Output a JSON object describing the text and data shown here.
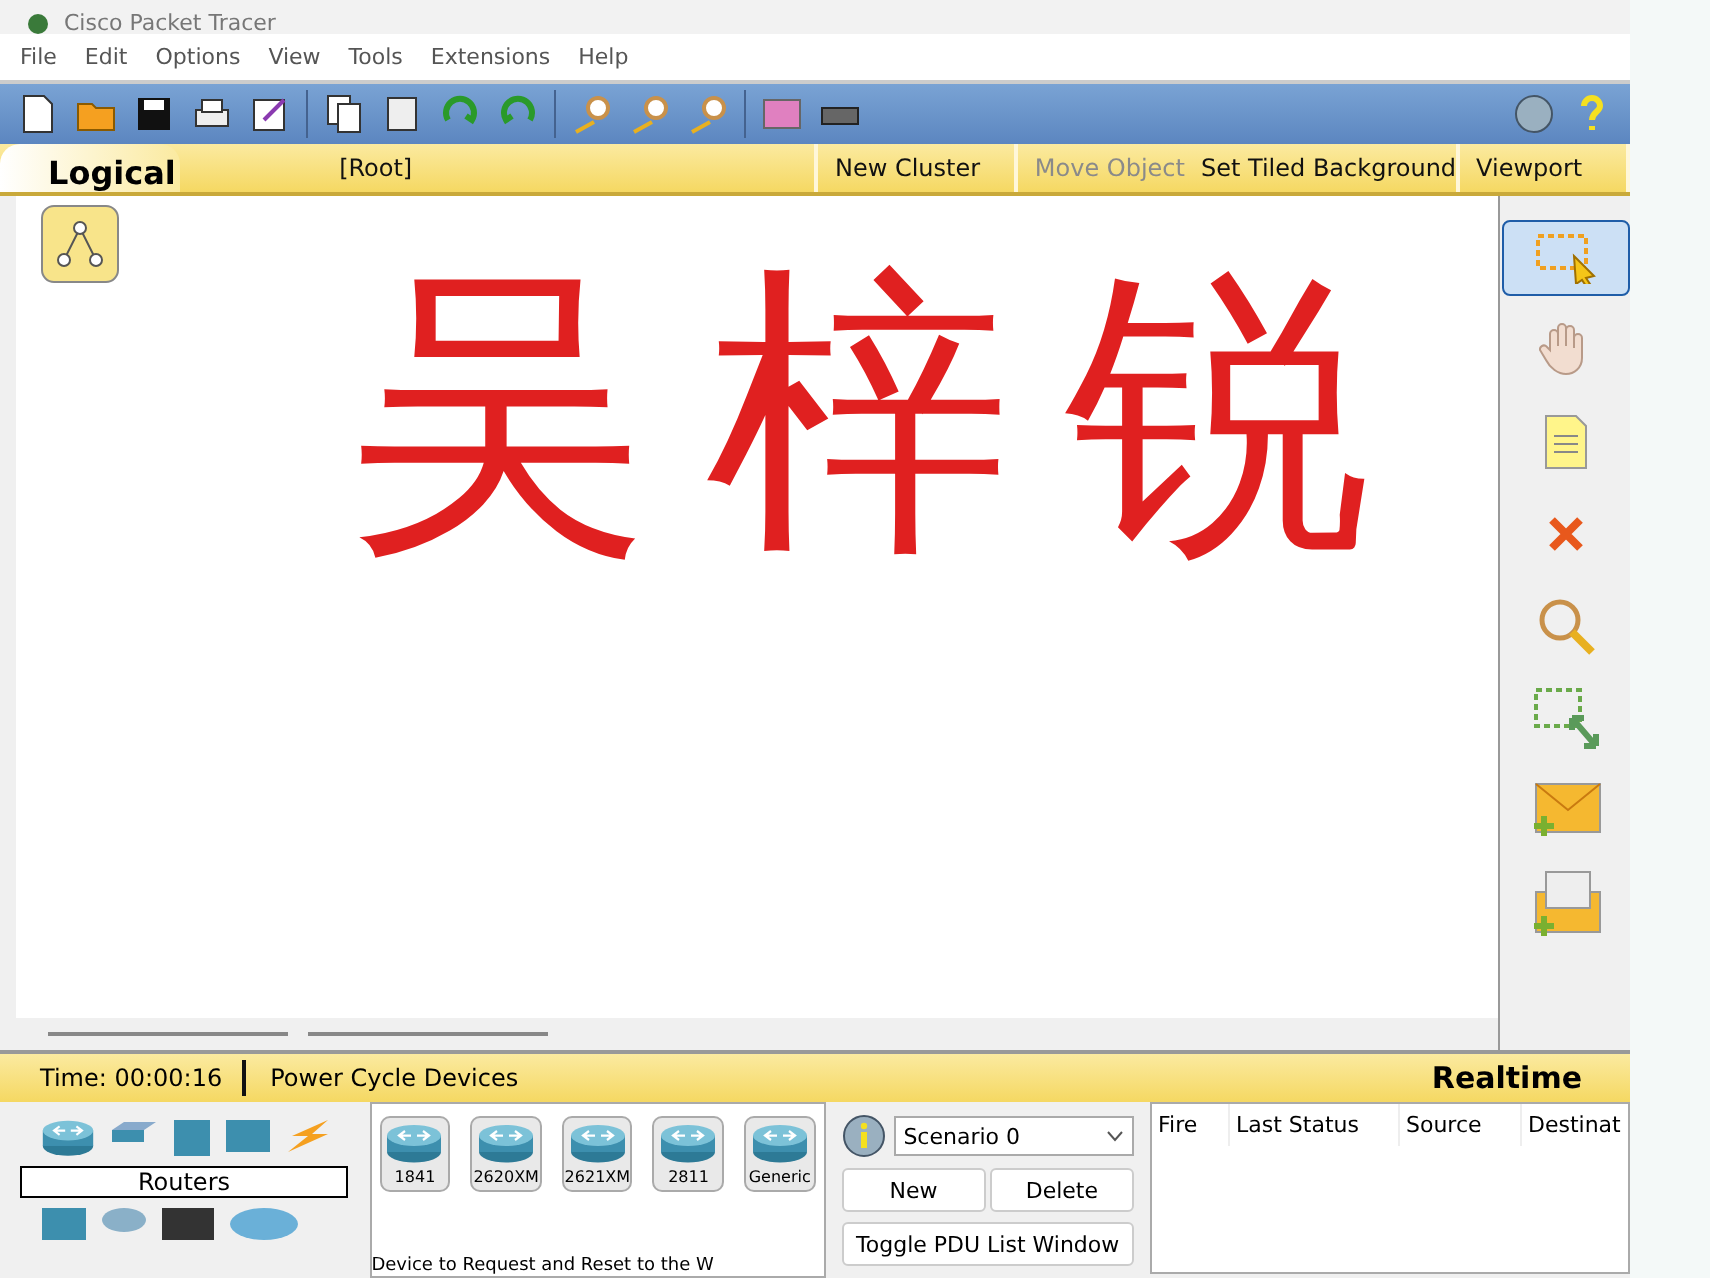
{
  "window": {
    "title": "Cisco Packet Tracer"
  },
  "menu": [
    "File",
    "Edit",
    "Options",
    "View",
    "Tools",
    "Extensions",
    "Help"
  ],
  "workspace_bar": {
    "tab": "Logical",
    "path": "[Root]",
    "actions": [
      {
        "label": "New Cluster",
        "disabled": false
      },
      {
        "label": "Move Object",
        "disabled": true
      },
      {
        "label": "Set Tiled Background",
        "disabled": false
      },
      {
        "label": "Viewport",
        "disabled": false
      }
    ]
  },
  "canvas": {
    "handwriting": "吴梓锐"
  },
  "tools": [
    {
      "kind": "select",
      "selected": true
    },
    {
      "kind": "hand",
      "selected": false
    },
    {
      "kind": "note",
      "selected": false
    },
    {
      "kind": "delete",
      "selected": false
    },
    {
      "kind": "inspect",
      "selected": false
    },
    {
      "kind": "resize",
      "selected": false
    },
    {
      "kind": "simple-pdu",
      "selected": false
    },
    {
      "kind": "complex-pdu",
      "selected": false
    }
  ],
  "mode_bar": {
    "time": "Time: 00:00:16",
    "action": "Power Cycle Devices",
    "mode": "Realtime"
  },
  "device_categories": {
    "label": "Routers"
  },
  "devices": [
    "1841",
    "2620XM",
    "2621XM",
    "2811",
    "Generic"
  ],
  "device_hint": "Device to Request and Reset to the W",
  "scenario": {
    "value": "Scenario 0",
    "buttons": [
      "New",
      "Delete"
    ],
    "toggle": "Toggle PDU List Window"
  },
  "pdu_table": {
    "columns": [
      "Fire",
      "Last Status",
      "Source",
      "Destinat"
    ]
  }
}
